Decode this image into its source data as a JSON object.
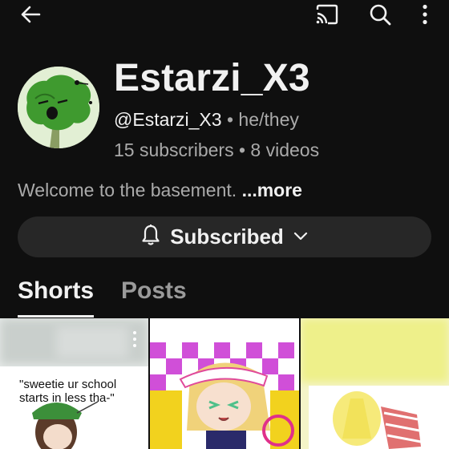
{
  "topbar": {
    "back_icon": "arrow-left-icon",
    "cast_icon": "cast-icon",
    "search_icon": "search-icon",
    "menu_icon": "more-vert-icon"
  },
  "channel": {
    "name": "Estarzi_X3",
    "handle": "@Estarzi_X3",
    "separator": "•",
    "pronouns": "he/they",
    "subscribers": "15 subscribers",
    "videos": "8 videos",
    "description": "Welcome to the basement.",
    "more_label": "...more"
  },
  "subscribe": {
    "label": "Subscribed",
    "bell_icon": "bell-icon",
    "chevron_icon": "chevron-down-icon"
  },
  "tabs": [
    {
      "label": "Shorts",
      "active": true
    },
    {
      "label": "Posts",
      "active": false
    }
  ],
  "shorts": [
    {
      "caption_line1": "\"sweetie ur school",
      "caption_line2": "starts in less tha-\""
    },
    {},
    {}
  ],
  "colors": {
    "background": "#0f0f0f",
    "button_bg": "#272727",
    "primary_text": "#f1f1f1",
    "secondary_text": "#aaaaaa"
  }
}
